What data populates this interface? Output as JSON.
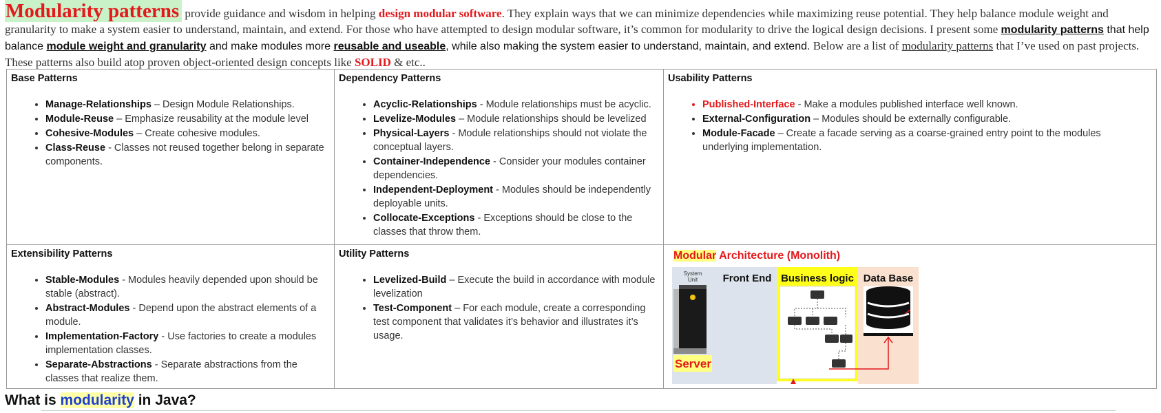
{
  "intro": {
    "title": "Modularity patterns",
    "t1": " provide guidance and wisdom in helping ",
    "t2": "design modular software",
    "t3": ". They explain ways that we can minimize dependencies while maximizing reuse potential. They help balance module weight and granularity to make a system easier to understand, maintain, and extend. For those who have attempted to design modular software, it’s common for modularity to drive the logical design decisions. I present some ",
    "t4": "modularity patterns",
    "t5": " that help balance ",
    "t6": "module weight and granularity",
    "t7": " and make modules more ",
    "t8": "reusable and useable",
    "t9": ", while also making the system easier to understand, maintain, and extend.",
    "t10": " Below are a list of ",
    "t11": "modularity patterns",
    "t12": " that I’ve used on past projects. These patterns also build atop proven object-oriented design concepts like ",
    "t13": "SOLID",
    "t14": " & etc.."
  },
  "base": {
    "heading": "Base Patterns",
    "items": [
      {
        "name": "Manage-Relationships",
        "desc": " – Design Module Relationships."
      },
      {
        "name": "Module-Reuse",
        "desc": " – Emphasize reusability at the module level"
      },
      {
        "name": "Cohesive-Modules",
        "desc": " – Create cohesive modules."
      },
      {
        "name": "Class-Reuse",
        "desc": " - Classes not reused together belong in separate components."
      }
    ]
  },
  "dependency": {
    "heading": "Dependency Patterns",
    "items": [
      {
        "name": "Acyclic-Relationships",
        "desc": " - Module relationships must be acyclic."
      },
      {
        "name": "Levelize-Modules",
        "desc": " – Module relationships should be levelized"
      },
      {
        "name": "Physical-Layers",
        "desc": " - Module relationships should not violate the conceptual layers."
      },
      {
        "name": "Container-Independence",
        "desc": " - Consider your modules container dependencies."
      },
      {
        "name": "Independent-Deployment",
        "desc": " - Modules should be independently deployable units."
      },
      {
        "name": "Collocate-Exceptions",
        "desc": " - Exceptions should be close to the classes that throw them."
      }
    ]
  },
  "usability": {
    "heading": "Usability Patterns",
    "items": [
      {
        "name": "Published-Interface",
        "desc": " - Make a modules published interface well known."
      },
      {
        "name": "External-Configuration",
        "desc": " – Modules should be externally configurable."
      },
      {
        "name": "Module-Facade",
        "desc": " – Create a facade serving as a coarse-grained entry point to the modules underlying implementation."
      }
    ]
  },
  "extensibility": {
    "heading": "Extensibility Patterns",
    "items": [
      {
        "name": "Stable-Modules",
        "desc": " - Modules heavily depended upon should be stable (abstract)."
      },
      {
        "name": "Abstract-Modules",
        "desc": " - Depend upon the abstract elements of a module."
      },
      {
        "name": "Implementation-Factory",
        "desc": " - Use factories to create a modules implementation classes."
      },
      {
        "name": "Separate-Abstractions",
        "desc": " - Separate abstractions from the classes that realize them."
      }
    ]
  },
  "utility": {
    "heading": "Utility Patterns",
    "items": [
      {
        "name": "Levelized-Build",
        "desc": " – Execute the build in accordance with module levelization"
      },
      {
        "name": "Test-Component",
        "desc": " – For each module, create a corresponding test component that validates it’s behavior and illustrates it’s usage."
      }
    ]
  },
  "diagram": {
    "title_hl": "Modular",
    "title_rest": " Architecture (Monolith)",
    "system_unit_line1": "System",
    "system_unit_line2": "Unit",
    "front_end": "Front End",
    "business_logic": "Business logic",
    "data_base": "Data Base",
    "server": "Server",
    "colors": {
      "server_bg": "#dce3ec",
      "frontend_bg": "#dde3ec",
      "business_bg": "#ffff1a",
      "database_bg": "#f9e0cf",
      "accent": "#e3191c"
    }
  },
  "footer": {
    "t1": "What is ",
    "t2": "modularity",
    "t3": " in Java?"
  }
}
